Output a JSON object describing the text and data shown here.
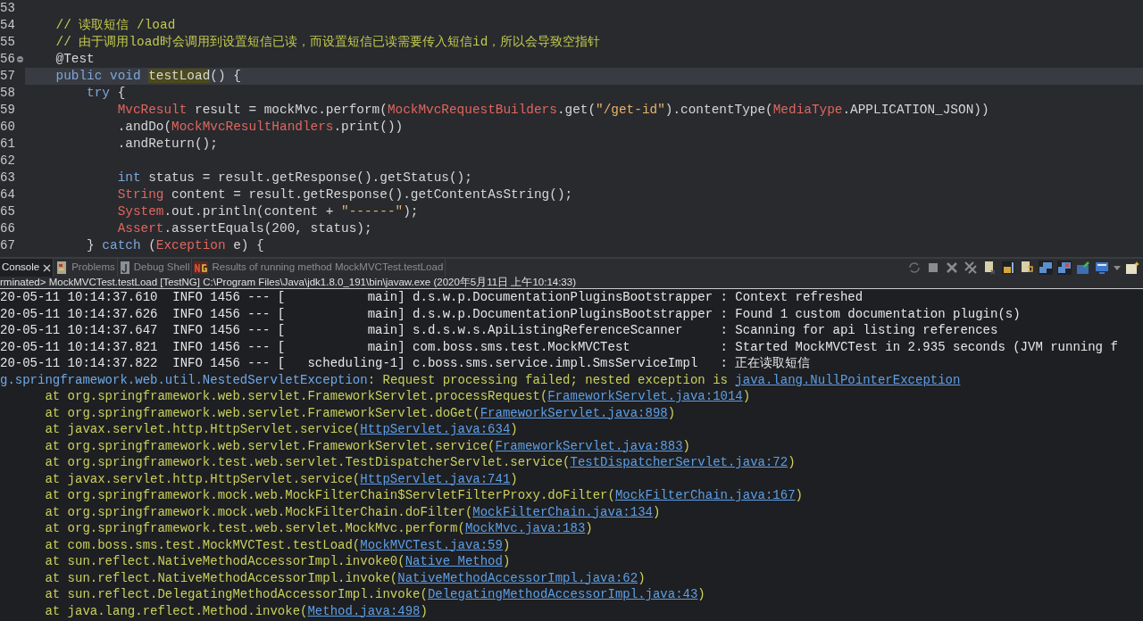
{
  "editor": {
    "lines": [
      {
        "number": "53"
      },
      {
        "number": "54",
        "tokens": [
          {
            "kind": "comment",
            "text": "    // 读取短信 /load"
          }
        ]
      },
      {
        "number": "55",
        "tokens": [
          {
            "kind": "comment",
            "text": "    // 由于调用load时会调用到设置短信已读，而设置短信已读需要传入短信id，所以会导致空指针"
          }
        ]
      },
      {
        "number": "56",
        "fold": true,
        "tokens": [
          {
            "kind": "plain",
            "text": "    @Test"
          }
        ]
      },
      {
        "number": "57",
        "current": true,
        "tokens": [
          {
            "kind": "keyword",
            "text": "    public void "
          },
          {
            "kind": "occurrence",
            "text": "testLoad"
          },
          {
            "kind": "plain",
            "text": "() {"
          }
        ]
      },
      {
        "number": "58",
        "tokens": [
          {
            "kind": "keyword",
            "text": "        try"
          },
          {
            "kind": "plain",
            "text": " {"
          }
        ]
      },
      {
        "number": "59",
        "tokens": [
          {
            "kind": "type",
            "text": "            MvcResult"
          },
          {
            "kind": "plain",
            "text": " result = mockMvc.perform("
          },
          {
            "kind": "type",
            "text": "MockMvcRequestBuilders"
          },
          {
            "kind": "plain",
            "text": ".get("
          },
          {
            "kind": "string",
            "text": "\"/get-id\""
          },
          {
            "kind": "plain",
            "text": ").contentType("
          },
          {
            "kind": "type",
            "text": "MediaType"
          },
          {
            "kind": "plain",
            "text": ".APPLICATION_JSON))"
          }
        ]
      },
      {
        "number": "60",
        "tokens": [
          {
            "kind": "plain",
            "text": "            .andDo("
          },
          {
            "kind": "type",
            "text": "MockMvcResultHandlers"
          },
          {
            "kind": "plain",
            "text": ".print())"
          }
        ]
      },
      {
        "number": "61",
        "tokens": [
          {
            "kind": "plain",
            "text": "            .andReturn();"
          }
        ]
      },
      {
        "number": "62"
      },
      {
        "number": "63",
        "tokens": [
          {
            "kind": "keyword",
            "text": "            int"
          },
          {
            "kind": "plain",
            "text": " status = result.getResponse().getStatus();"
          }
        ]
      },
      {
        "number": "64",
        "tokens": [
          {
            "kind": "type",
            "text": "            String"
          },
          {
            "kind": "plain",
            "text": " content = result.getResponse().getContentAsString();"
          }
        ]
      },
      {
        "number": "65",
        "tokens": [
          {
            "kind": "type",
            "text": "            System"
          },
          {
            "kind": "plain",
            "text": ".out.println(content + "
          },
          {
            "kind": "string",
            "text": "\"------\""
          },
          {
            "kind": "plain",
            "text": ");"
          }
        ]
      },
      {
        "number": "66",
        "tokens": [
          {
            "kind": "type",
            "text": "            Assert"
          },
          {
            "kind": "plain",
            "text": ".assertEquals(200, status);"
          }
        ]
      },
      {
        "number": "67",
        "tokens": [
          {
            "kind": "plain",
            "text": "        } "
          },
          {
            "kind": "keyword",
            "text": "catch"
          },
          {
            "kind": "plain",
            "text": " ("
          },
          {
            "kind": "type",
            "text": "Exception"
          },
          {
            "kind": "plain",
            "text": " e) {"
          }
        ]
      }
    ]
  },
  "console": {
    "tabs": [
      {
        "label": "Console",
        "kind": "console",
        "selected": true,
        "closable": true
      },
      {
        "label": "Problems",
        "kind": "problems",
        "selected": false
      },
      {
        "label": "Debug Shell",
        "kind": "debug-shell",
        "selected": false
      },
      {
        "label": "Results of running method MockMVCTest.testLoad",
        "kind": "testng",
        "selected": false
      }
    ],
    "status": "rminated> MockMVCTest.testLoad [TestNG] C:\\Program Files\\Java\\jdk1.8.0_191\\bin\\javaw.exe (2020年5月11日 上午10:14:33)",
    "lines": [
      {
        "segments": [
          {
            "kind": "log",
            "text": "20-05-11 10:14:37.610  INFO 1456 --- [           main] d.s.w.p.DocumentationPluginsBootstrapper : Context refreshed"
          }
        ]
      },
      {
        "segments": [
          {
            "kind": "log",
            "text": "20-05-11 10:14:37.626  INFO 1456 --- [           main] d.s.w.p.DocumentationPluginsBootstrapper : Found 1 custom documentation plugin(s)"
          }
        ]
      },
      {
        "segments": [
          {
            "kind": "log",
            "text": "20-05-11 10:14:37.647  INFO 1456 --- [           main] s.d.s.w.s.ApiListingReferenceScanner     : Scanning for api listing references"
          }
        ]
      },
      {
        "segments": [
          {
            "kind": "log",
            "text": "20-05-11 10:14:37.821  INFO 1456 --- [           main] com.boss.sms.test.MockMVCTest            : Started MockMVCTest in 2.935 seconds (JVM running f"
          }
        ]
      },
      {
        "segments": [
          {
            "kind": "log",
            "text": "20-05-11 10:14:37.822  INFO 1456 --- [   scheduling-1] c.boss.sms.service.impl.SmsServiceImpl   : 正在读取短信"
          }
        ]
      },
      {
        "segments": [
          {
            "kind": "exception",
            "text": "g.springframework.web.util.NestedServletException"
          },
          {
            "kind": "error",
            "text": ": Request processing failed; nested exception is "
          },
          {
            "kind": "link",
            "text": "java.lang.NullPointerException"
          }
        ]
      },
      {
        "segments": [
          {
            "kind": "error",
            "text": "      at org.springframework.web.servlet.FrameworkServlet.processRequest("
          },
          {
            "kind": "link",
            "text": "FrameworkServlet.java:1014"
          },
          {
            "kind": "error",
            "text": ")"
          }
        ]
      },
      {
        "segments": [
          {
            "kind": "error",
            "text": "      at org.springframework.web.servlet.FrameworkServlet.doGet("
          },
          {
            "kind": "link",
            "text": "FrameworkServlet.java:898"
          },
          {
            "kind": "error",
            "text": ")"
          }
        ]
      },
      {
        "segments": [
          {
            "kind": "error",
            "text": "      at javax.servlet.http.HttpServlet.service("
          },
          {
            "kind": "link",
            "text": "HttpServlet.java:634"
          },
          {
            "kind": "error",
            "text": ")"
          }
        ]
      },
      {
        "segments": [
          {
            "kind": "error",
            "text": "      at org.springframework.web.servlet.FrameworkServlet.service("
          },
          {
            "kind": "link",
            "text": "FrameworkServlet.java:883"
          },
          {
            "kind": "error",
            "text": ")"
          }
        ]
      },
      {
        "segments": [
          {
            "kind": "error",
            "text": "      at org.springframework.test.web.servlet.TestDispatcherServlet.service("
          },
          {
            "kind": "link",
            "text": "TestDispatcherServlet.java:72"
          },
          {
            "kind": "error",
            "text": ")"
          }
        ]
      },
      {
        "segments": [
          {
            "kind": "error",
            "text": "      at javax.servlet.http.HttpServlet.service("
          },
          {
            "kind": "link",
            "text": "HttpServlet.java:741"
          },
          {
            "kind": "error",
            "text": ")"
          }
        ]
      },
      {
        "segments": [
          {
            "kind": "error",
            "text": "      at org.springframework.mock.web.MockFilterChain$ServletFilterProxy.doFilter("
          },
          {
            "kind": "link",
            "text": "MockFilterChain.java:167"
          },
          {
            "kind": "error",
            "text": ")"
          }
        ]
      },
      {
        "segments": [
          {
            "kind": "error",
            "text": "      at org.springframework.mock.web.MockFilterChain.doFilter("
          },
          {
            "kind": "link",
            "text": "MockFilterChain.java:134"
          },
          {
            "kind": "error",
            "text": ")"
          }
        ]
      },
      {
        "segments": [
          {
            "kind": "error",
            "text": "      at org.springframework.test.web.servlet.MockMvc.perform("
          },
          {
            "kind": "link",
            "text": "MockMvc.java:183"
          },
          {
            "kind": "error",
            "text": ")"
          }
        ]
      },
      {
        "segments": [
          {
            "kind": "error",
            "text": "      at com.boss.sms.test.MockMVCTest.testLoad("
          },
          {
            "kind": "link",
            "text": "MockMVCTest.java:59"
          },
          {
            "kind": "error",
            "text": ")"
          }
        ]
      },
      {
        "segments": [
          {
            "kind": "error",
            "text": "      at sun.reflect.NativeMethodAccessorImpl.invoke0("
          },
          {
            "kind": "link",
            "text": "Native Method"
          },
          {
            "kind": "error",
            "text": ")"
          }
        ]
      },
      {
        "segments": [
          {
            "kind": "error",
            "text": "      at sun.reflect.NativeMethodAccessorImpl.invoke("
          },
          {
            "kind": "link",
            "text": "NativeMethodAccessorImpl.java:62"
          },
          {
            "kind": "error",
            "text": ")"
          }
        ]
      },
      {
        "segments": [
          {
            "kind": "error",
            "text": "      at sun.reflect.DelegatingMethodAccessorImpl.invoke("
          },
          {
            "kind": "link",
            "text": "DelegatingMethodAccessorImpl.java:43"
          },
          {
            "kind": "error",
            "text": ")"
          }
        ]
      },
      {
        "segments": [
          {
            "kind": "error",
            "text": "      at java.lang.reflect.Method.invoke("
          },
          {
            "kind": "link",
            "text": "Method.java:498"
          },
          {
            "kind": "error",
            "text": ")"
          }
        ]
      }
    ]
  }
}
